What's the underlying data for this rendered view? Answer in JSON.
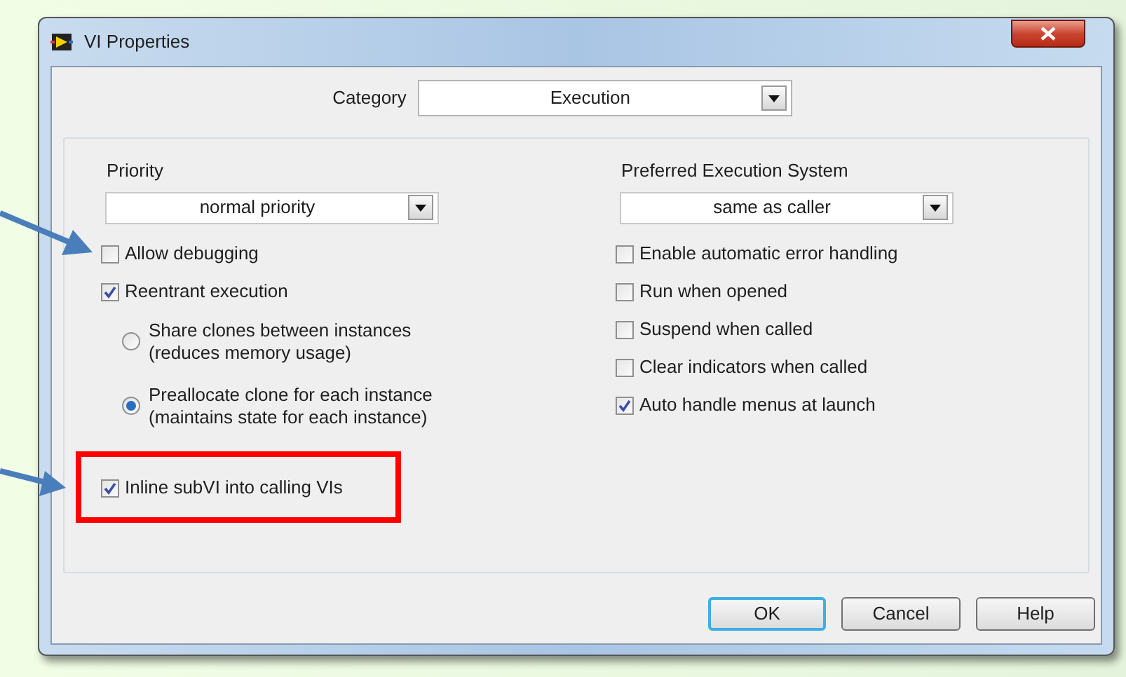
{
  "window": {
    "title": "VI Properties"
  },
  "category": {
    "label": "Category",
    "value": "Execution"
  },
  "left": {
    "label": "Priority",
    "value": "normal priority",
    "options": [
      {
        "kind": "checkbox",
        "label": "Allow debugging",
        "checked": false
      },
      {
        "kind": "checkbox",
        "label": "Reentrant execution",
        "checked": true
      },
      {
        "kind": "radio",
        "label": "Share clones between instances",
        "sublabel": "(reduces memory usage)",
        "selected": false
      },
      {
        "kind": "radio",
        "label": "Preallocate clone for each instance",
        "sublabel": "(maintains state for each instance)",
        "selected": true
      },
      {
        "kind": "checkbox",
        "label": "Inline subVI into calling VIs",
        "checked": true
      }
    ]
  },
  "right": {
    "label": "Preferred Execution System",
    "value": "same as caller",
    "options": [
      {
        "kind": "checkbox",
        "label": "Enable automatic error handling",
        "checked": false
      },
      {
        "kind": "checkbox",
        "label": "Run when opened",
        "checked": false
      },
      {
        "kind": "checkbox",
        "label": "Suspend when called",
        "checked": false
      },
      {
        "kind": "checkbox",
        "label": "Clear indicators when called",
        "checked": false
      },
      {
        "kind": "checkbox",
        "label": "Auto handle menus at launch",
        "checked": true
      }
    ]
  },
  "buttons": [
    {
      "label": "OK",
      "default": true
    },
    {
      "label": "Cancel",
      "default": false
    },
    {
      "label": "Help",
      "default": false
    }
  ]
}
